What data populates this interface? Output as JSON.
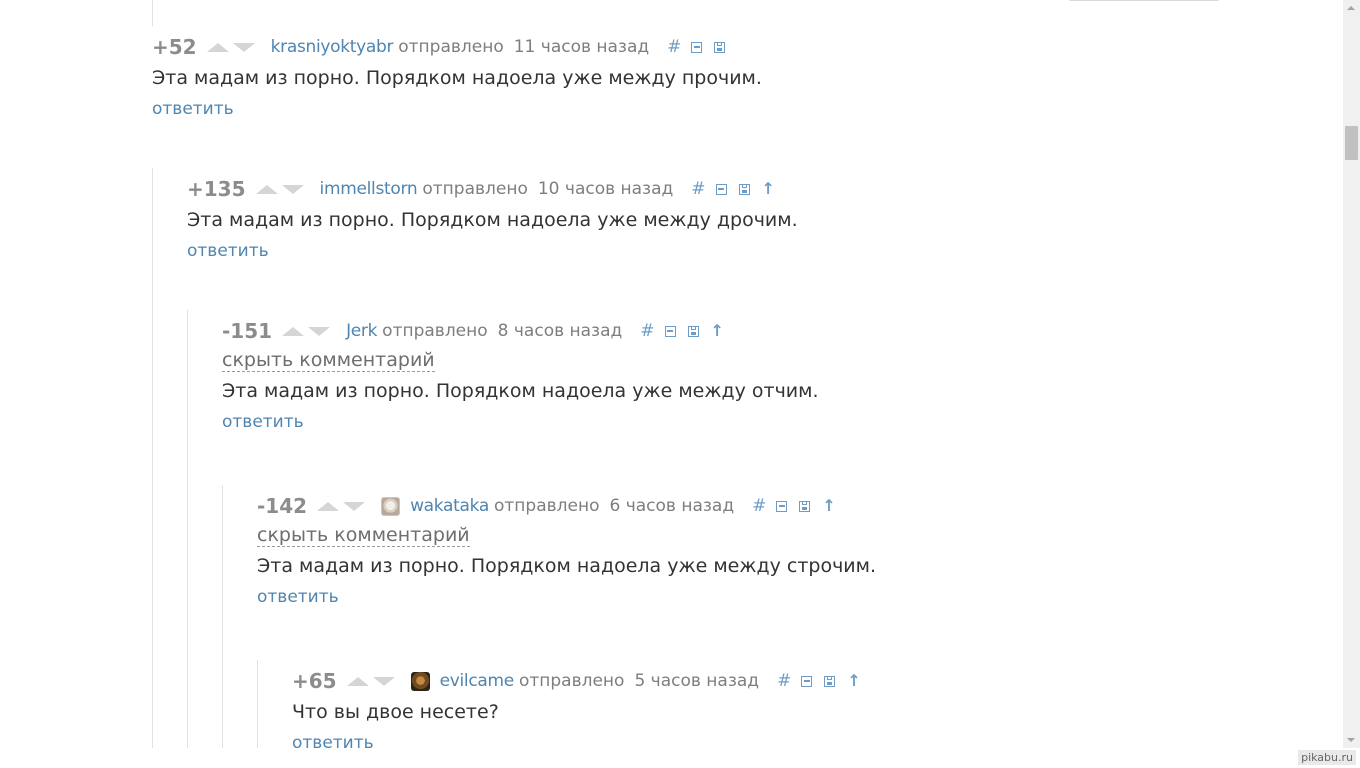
{
  "labels": {
    "sent": "отправлено",
    "hide_comment": "скрыть комментарий",
    "reply": "ответить",
    "anchor": "#"
  },
  "comments": [
    {
      "rating": "+52",
      "author": "krasniyoktyabr",
      "time": "11 часов назад",
      "text": "Эта мадам из порно. Порядком надоела уже между прочим.",
      "hidden_link": false,
      "avatar": null
    },
    {
      "rating": "+135",
      "author": "immellstorn",
      "time": "10 часов назад",
      "text": "Эта мадам из порно. Порядком надоела уже между дрочим.",
      "hidden_link": false,
      "avatar": null
    },
    {
      "rating": "-151",
      "author": "Jerk",
      "time": "8 часов назад",
      "text": "Эта мадам из порно. Порядком надоела уже между отчим.",
      "hidden_link": true,
      "avatar": null
    },
    {
      "rating": "-142",
      "author": "wakataka",
      "time": "6 часов назад",
      "text": "Эта мадам из порно. Порядком надоела уже между строчим.",
      "hidden_link": true,
      "avatar": "light"
    },
    {
      "rating": "+65",
      "author": "evilcame",
      "time": "5 часов назад",
      "text": "Что вы двое несете?",
      "hidden_link": false,
      "avatar": "dark"
    }
  ],
  "watermark": "pikabu.ru",
  "colors": {
    "link": "#4f85b0",
    "icon": "#6d9dc7",
    "rating": "#8c8c8c",
    "text": "#333333"
  }
}
